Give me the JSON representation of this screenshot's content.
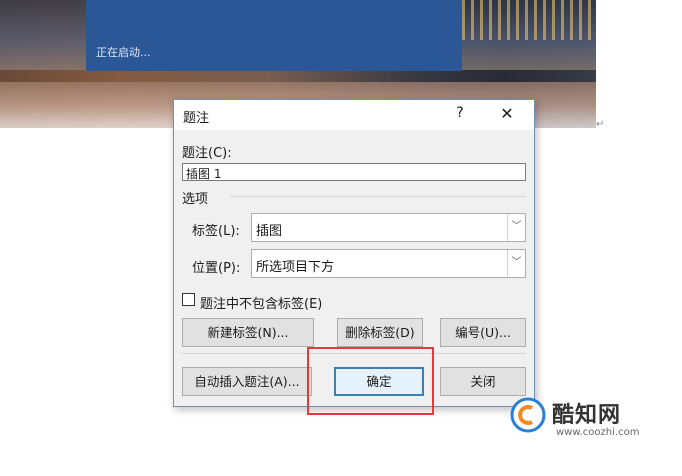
{
  "splash": {
    "status": "正在启动..."
  },
  "dialog": {
    "title": "题注",
    "help_glyph": "?",
    "close_glyph": "✕",
    "caption_label": "题注(C):",
    "caption_value": "插图 1",
    "options_heading": "选项",
    "label_label": "标签(L):",
    "label_value": "插图",
    "position_label": "位置(P):",
    "position_value": "所选项目下方",
    "exclude_label_text": "题注中不包含标签(E)",
    "exclude_label_checked": false,
    "buttons": {
      "new_label": "新建标签(N)...",
      "delete_label": "删除标签(D)",
      "numbering": "编号(U)...",
      "autocaption": "自动插入题注(A)...",
      "ok": "确定",
      "close": "关闭"
    }
  },
  "watermark": {
    "brand": "酷知网",
    "url": "www.coozhi.com"
  },
  "colors": {
    "splash": "#2b5797",
    "highlight": "#e23b3b",
    "dialog_border": "#6b8fbf"
  }
}
